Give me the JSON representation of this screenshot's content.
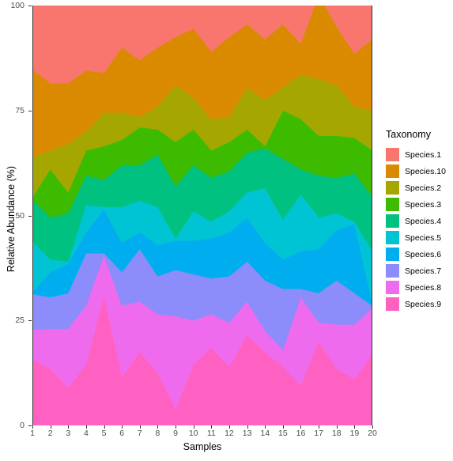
{
  "chart_data": {
    "type": "area",
    "title": "",
    "xlabel": "Samples",
    "ylabel": "Relative Abundance (%)",
    "xlim": [
      1,
      20
    ],
    "ylim": [
      0,
      100
    ],
    "grid": false,
    "stacked": true,
    "legend_position": "right",
    "legend_title": "Taxonomy",
    "x": [
      1,
      2,
      3,
      4,
      5,
      6,
      7,
      8,
      9,
      10,
      11,
      12,
      13,
      14,
      15,
      16,
      17,
      18,
      19,
      20
    ],
    "xtick_labels": [
      "1",
      "2",
      "3",
      "4",
      "5",
      "6",
      "7",
      "8",
      "9",
      "10",
      "11",
      "12",
      "13",
      "14",
      "15",
      "16",
      "17",
      "18",
      "19",
      "20"
    ],
    "ytick_labels": [
      "0",
      "25",
      "50",
      "75",
      "100"
    ],
    "ytick_values": [
      0,
      25,
      50,
      75,
      100
    ],
    "stack_order": [
      "Species.1",
      "Species.10",
      "Species.2",
      "Species.3",
      "Species.4",
      "Species.5",
      "Species.6",
      "Species.7",
      "Species.8",
      "Species.9"
    ],
    "series": [
      {
        "name": "Species.9",
        "color": "#FF61C3",
        "values": [
          15.8,
          13.5,
          9.0,
          14.5,
          31.0,
          11.5,
          17.5,
          12.5,
          4.0,
          14.5,
          18.5,
          14.0,
          21.5,
          17.5,
          14.0,
          9.5,
          20.0,
          13.5,
          11.0,
          17.0
        ]
      },
      {
        "name": "Species.8",
        "color": "#EE6BEE",
        "values": [
          7.0,
          9.5,
          14.0,
          14.0,
          9.5,
          17.0,
          12.0,
          14.0,
          22.0,
          10.5,
          8.0,
          10.5,
          8.0,
          5.0,
          4.0,
          21.0,
          4.5,
          10.5,
          13.0,
          11.0
        ]
      },
      {
        "name": "Species.7",
        "color": "#8C8CFA",
        "values": [
          8.5,
          7.5,
          8.5,
          12.5,
          0.5,
          8.0,
          12.5,
          9.0,
          11.0,
          11.0,
          8.5,
          11.0,
          9.5,
          12.0,
          14.5,
          2.0,
          7.0,
          10.5,
          7.5,
          0.5
        ]
      },
      {
        "name": "Species.6",
        "color": "#00AEEF",
        "values": [
          0.5,
          6.0,
          7.0,
          5.0,
          10.5,
          7.0,
          4.0,
          7.5,
          7.0,
          8.0,
          9.5,
          10.5,
          10.5,
          9.0,
          7.0,
          9.0,
          10.5,
          12.0,
          16.5,
          0.5
        ]
      },
      {
        "name": "Species.5",
        "color": "#00C4D4",
        "values": [
          12.0,
          3.0,
          0.5,
          6.5,
          0.5,
          8.5,
          7.5,
          9.0,
          0.5,
          7.0,
          4.0,
          5.0,
          6.0,
          13.0,
          9.5,
          13.5,
          7.5,
          4.0,
          0.5,
          12.5
        ]
      },
      {
        "name": "Species.4",
        "color": "#00C180",
        "values": [
          10.0,
          10.0,
          11.5,
          7.0,
          6.5,
          10.0,
          8.5,
          12.5,
          12.5,
          11.0,
          10.5,
          9.5,
          9.5,
          9.5,
          14.5,
          6.0,
          10.0,
          8.5,
          11.5,
          13.0
        ]
      },
      {
        "name": "Species.3",
        "color": "#3DBB00",
        "values": [
          0.5,
          11.5,
          5.0,
          6.0,
          8.0,
          6.0,
          9.0,
          6.0,
          10.5,
          8.5,
          6.5,
          7.0,
          5.5,
          0.5,
          11.5,
          12.0,
          9.5,
          10.0,
          8.5,
          11.0
        ]
      },
      {
        "name": "Species.2",
        "color": "#A6A600",
        "values": [
          9.5,
          4.5,
          11.5,
          4.5,
          8.0,
          6.5,
          2.5,
          5.5,
          13.5,
          7.5,
          7.5,
          6.0,
          10.0,
          11.0,
          5.5,
          10.5,
          13.5,
          12.0,
          7.5,
          9.5
        ]
      },
      {
        "name": "Species.10",
        "color": "#D98A00",
        "values": [
          21.0,
          16.0,
          14.5,
          14.5,
          9.5,
          15.5,
          13.5,
          14.0,
          11.5,
          16.5,
          16.0,
          19.0,
          15.0,
          14.5,
          15.0,
          7.5,
          20.0,
          14.0,
          12.5,
          17.0
        ]
      },
      {
        "name": "Species.1",
        "color": "#F8766D",
        "values": [
          15.2,
          18.5,
          18.5,
          15.5,
          16.0,
          10.0,
          13.0,
          10.0,
          7.5,
          5.5,
          11.0,
          7.5,
          4.5,
          8.0,
          4.5,
          9.0,
          2.5,
          5.0,
          11.5,
          8.0
        ]
      }
    ],
    "legend_entries": [
      {
        "label": "Species.1",
        "color": "#F8766D"
      },
      {
        "label": "Species.10",
        "color": "#D98A00"
      },
      {
        "label": "Species.2",
        "color": "#A6A600"
      },
      {
        "label": "Species.3",
        "color": "#3DBB00"
      },
      {
        "label": "Species.4",
        "color": "#00C180"
      },
      {
        "label": "Species.5",
        "color": "#00C4D4"
      },
      {
        "label": "Species.6",
        "color": "#00AEEF"
      },
      {
        "label": "Species.7",
        "color": "#8C8CFA"
      },
      {
        "label": "Species.8",
        "color": "#EE6BEE"
      },
      {
        "label": "Species.9",
        "color": "#FF61C3"
      }
    ]
  },
  "axes": {
    "y_title": "Relative Abundance (%)",
    "x_title": "Samples"
  },
  "legend": {
    "title": "Taxonomy"
  }
}
